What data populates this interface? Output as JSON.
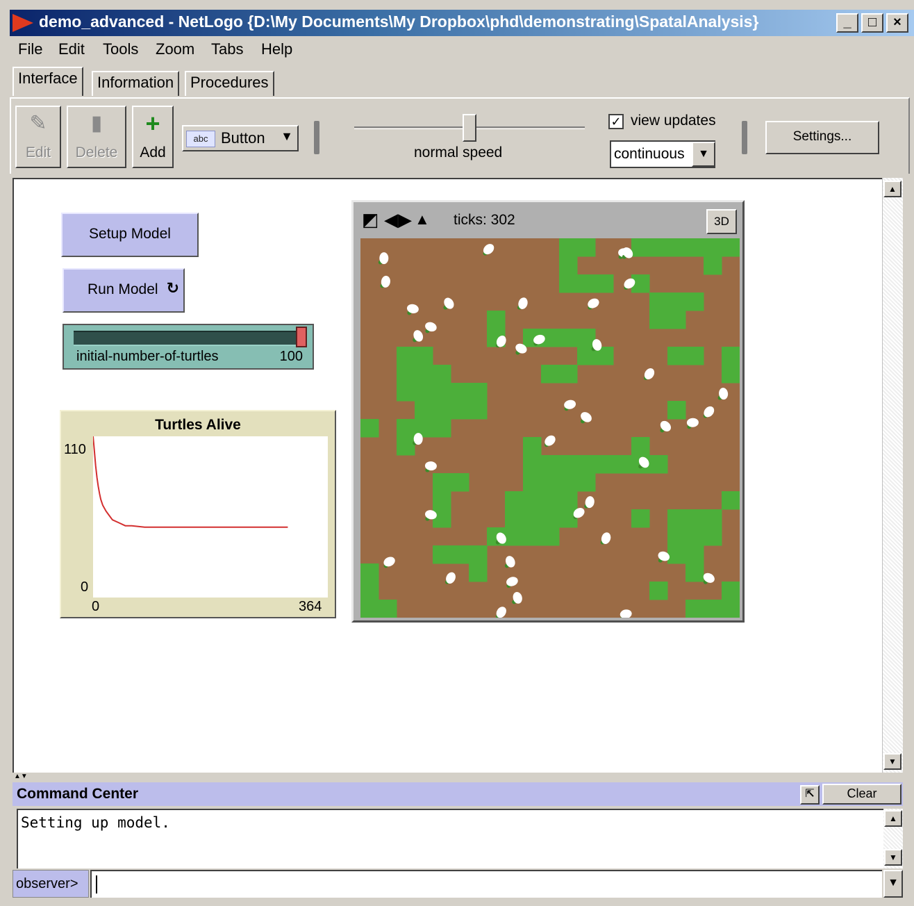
{
  "window": {
    "title": "demo_advanced - NetLogo {D:\\My Documents\\My Dropbox\\phd\\demonstrating\\SpatalAnalysis}",
    "controls": {
      "minimize": "_",
      "maximize": "□",
      "close": "×"
    }
  },
  "menu": [
    "File",
    "Edit",
    "Tools",
    "Zoom",
    "Tabs",
    "Help"
  ],
  "tabs": [
    {
      "label": "Interface",
      "active": true
    },
    {
      "label": "Information",
      "active": false
    },
    {
      "label": "Procedures",
      "active": false
    }
  ],
  "toolbar": {
    "edit_label": "Edit",
    "delete_label": "Delete",
    "add_label": "Add",
    "widget_type": "Button",
    "widget_type_icon_text": "abc",
    "speed_label": "normal speed",
    "speed_fraction": 0.5,
    "view_updates_label": "view updates",
    "view_updates_checked": true,
    "update_mode": "continuous",
    "settings_label": "Settings..."
  },
  "widgets": {
    "setup_button": "Setup Model",
    "run_button": "Run Model",
    "slider": {
      "name": "initial-number-of-turtles",
      "value": "100",
      "fraction": 1.0
    },
    "plot": {
      "title": "Turtles Alive",
      "y_max_label": "110",
      "y_min_label": "0",
      "x_min_label": "0",
      "x_max_label": "364"
    }
  },
  "chart_data": {
    "type": "line",
    "title": "Turtles Alive",
    "xlim": [
      0,
      364
    ],
    "ylim": [
      0,
      110
    ],
    "series": [
      {
        "color": "#d32f2f",
        "x": [
          0,
          2,
          4,
          6,
          8,
          10,
          12,
          15,
          20,
          25,
          30,
          40,
          50,
          60,
          80,
          100,
          150,
          200,
          250,
          302
        ],
        "y": [
          110,
          100,
          90,
          82,
          76,
          71,
          67,
          63,
          59,
          56,
          53,
          51,
          49,
          49,
          48,
          48,
          48,
          48,
          48,
          48
        ]
      }
    ]
  },
  "view": {
    "ticks_label": "ticks: 302",
    "three_d_label": "3D",
    "grid_size": 21,
    "patch_color": "#9b6b45",
    "grass_color": "#4caf3a",
    "grass_cells": [
      [
        11,
        0
      ],
      [
        12,
        0
      ],
      [
        15,
        0
      ],
      [
        16,
        0
      ],
      [
        17,
        0
      ],
      [
        18,
        0
      ],
      [
        19,
        0
      ],
      [
        20,
        0
      ],
      [
        11,
        1
      ],
      [
        19,
        1
      ],
      [
        11,
        2
      ],
      [
        12,
        2
      ],
      [
        13,
        2
      ],
      [
        15,
        2
      ],
      [
        18,
        3
      ],
      [
        16,
        3
      ],
      [
        17,
        3
      ],
      [
        16,
        4
      ],
      [
        17,
        4
      ],
      [
        7,
        4
      ],
      [
        7,
        5
      ],
      [
        9,
        5
      ],
      [
        10,
        5
      ],
      [
        11,
        5
      ],
      [
        12,
        5
      ],
      [
        2,
        6
      ],
      [
        3,
        6
      ],
      [
        12,
        6
      ],
      [
        13,
        6
      ],
      [
        17,
        6
      ],
      [
        18,
        6
      ],
      [
        20,
        6
      ],
      [
        2,
        7
      ],
      [
        3,
        7
      ],
      [
        4,
        7
      ],
      [
        10,
        7
      ],
      [
        11,
        7
      ],
      [
        20,
        7
      ],
      [
        2,
        8
      ],
      [
        3,
        8
      ],
      [
        4,
        8
      ],
      [
        5,
        8
      ],
      [
        6,
        8
      ],
      [
        3,
        9
      ],
      [
        4,
        9
      ],
      [
        5,
        9
      ],
      [
        6,
        9
      ],
      [
        17,
        9
      ],
      [
        0,
        10
      ],
      [
        2,
        10
      ],
      [
        3,
        10
      ],
      [
        4,
        10
      ],
      [
        2,
        11
      ],
      [
        9,
        11
      ],
      [
        15,
        11
      ],
      [
        9,
        12
      ],
      [
        10,
        12
      ],
      [
        11,
        12
      ],
      [
        12,
        12
      ],
      [
        13,
        12
      ],
      [
        14,
        12
      ],
      [
        15,
        12
      ],
      [
        16,
        12
      ],
      [
        4,
        13
      ],
      [
        5,
        13
      ],
      [
        9,
        13
      ],
      [
        10,
        13
      ],
      [
        11,
        13
      ],
      [
        12,
        13
      ],
      [
        4,
        14
      ],
      [
        8,
        14
      ],
      [
        9,
        14
      ],
      [
        10,
        14
      ],
      [
        11,
        14
      ],
      [
        20,
        14
      ],
      [
        4,
        15
      ],
      [
        8,
        15
      ],
      [
        9,
        15
      ],
      [
        10,
        15
      ],
      [
        11,
        15
      ],
      [
        15,
        15
      ],
      [
        17,
        15
      ],
      [
        18,
        15
      ],
      [
        19,
        15
      ],
      [
        7,
        16
      ],
      [
        8,
        16
      ],
      [
        9,
        16
      ],
      [
        10,
        16
      ],
      [
        17,
        16
      ],
      [
        18,
        16
      ],
      [
        19,
        16
      ],
      [
        4,
        17
      ],
      [
        5,
        17
      ],
      [
        6,
        17
      ],
      [
        17,
        17
      ],
      [
        18,
        17
      ],
      [
        0,
        18
      ],
      [
        6,
        18
      ],
      [
        18,
        18
      ],
      [
        0,
        19
      ],
      [
        16,
        19
      ],
      [
        20,
        19
      ],
      [
        0,
        20
      ],
      [
        1,
        20
      ],
      [
        18,
        20
      ],
      [
        19,
        20
      ],
      [
        20,
        20
      ],
      [
        0,
        21
      ],
      [
        11,
        21
      ],
      [
        16,
        21
      ],
      [
        18,
        21
      ],
      [
        19,
        21
      ],
      [
        20,
        21
      ]
    ],
    "turtles": [
      [
        1.3,
        1.1
      ],
      [
        7.1,
        0.6
      ],
      [
        14.6,
        0.8
      ],
      [
        14.8,
        0.8
      ],
      [
        1.4,
        2.4
      ],
      [
        14.9,
        2.5
      ],
      [
        2.9,
        3.9
      ],
      [
        4.9,
        3.6
      ],
      [
        9.0,
        3.6
      ],
      [
        12.9,
        3.6
      ],
      [
        3.9,
        4.9
      ],
      [
        3.2,
        5.4
      ],
      [
        7.8,
        5.7
      ],
      [
        9.9,
        5.6
      ],
      [
        8.9,
        6.1
      ],
      [
        13.1,
        5.9
      ],
      [
        16.0,
        7.5
      ],
      [
        11.6,
        9.2
      ],
      [
        12.5,
        9.9
      ],
      [
        20.1,
        8.6
      ],
      [
        19.3,
        9.6
      ],
      [
        18.4,
        10.2
      ],
      [
        16.9,
        10.4
      ],
      [
        3.2,
        11.1
      ],
      [
        10.5,
        11.2
      ],
      [
        3.9,
        12.6
      ],
      [
        15.7,
        12.4
      ],
      [
        12.7,
        14.6
      ],
      [
        12.1,
        15.2
      ],
      [
        3.9,
        15.3
      ],
      [
        7.8,
        16.6
      ],
      [
        13.6,
        16.6
      ],
      [
        1.6,
        17.9
      ],
      [
        16.8,
        17.6
      ],
      [
        8.3,
        17.9
      ],
      [
        5.0,
        18.8
      ],
      [
        8.4,
        19.0
      ],
      [
        19.3,
        18.8
      ],
      [
        8.7,
        19.9
      ],
      [
        7.8,
        20.7
      ],
      [
        14.7,
        20.8
      ]
    ]
  },
  "command_center": {
    "title": "Command Center",
    "clear_label": "Clear",
    "output_text": "Setting up model.",
    "prompt": "observer>",
    "input_value": ""
  }
}
